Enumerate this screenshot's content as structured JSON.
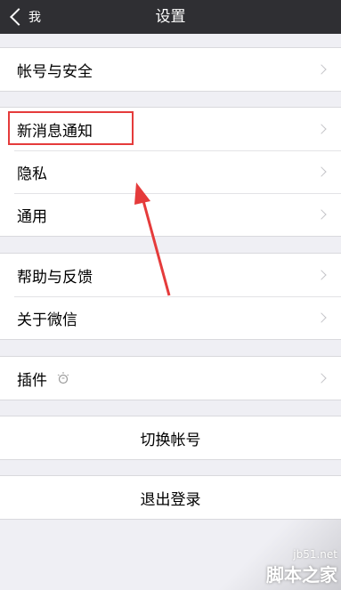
{
  "nav": {
    "back_label": "我",
    "title": "设置"
  },
  "groups": {
    "account": {
      "label": "帐号与安全"
    },
    "notify": {
      "label": "新消息通知"
    },
    "privacy": {
      "label": "隐私"
    },
    "general": {
      "label": "通用"
    },
    "help": {
      "label": "帮助与反馈"
    },
    "about": {
      "label": "关于微信"
    },
    "plugins": {
      "label": "插件"
    }
  },
  "buttons": {
    "switch_account": "切换帐号",
    "logout": "退出登录"
  },
  "watermark": {
    "url": "jb51.net",
    "text": "脚本之家"
  },
  "colors": {
    "navbar": "#2f2f33",
    "background": "#efeff4",
    "annotation": "#e53b3b"
  }
}
